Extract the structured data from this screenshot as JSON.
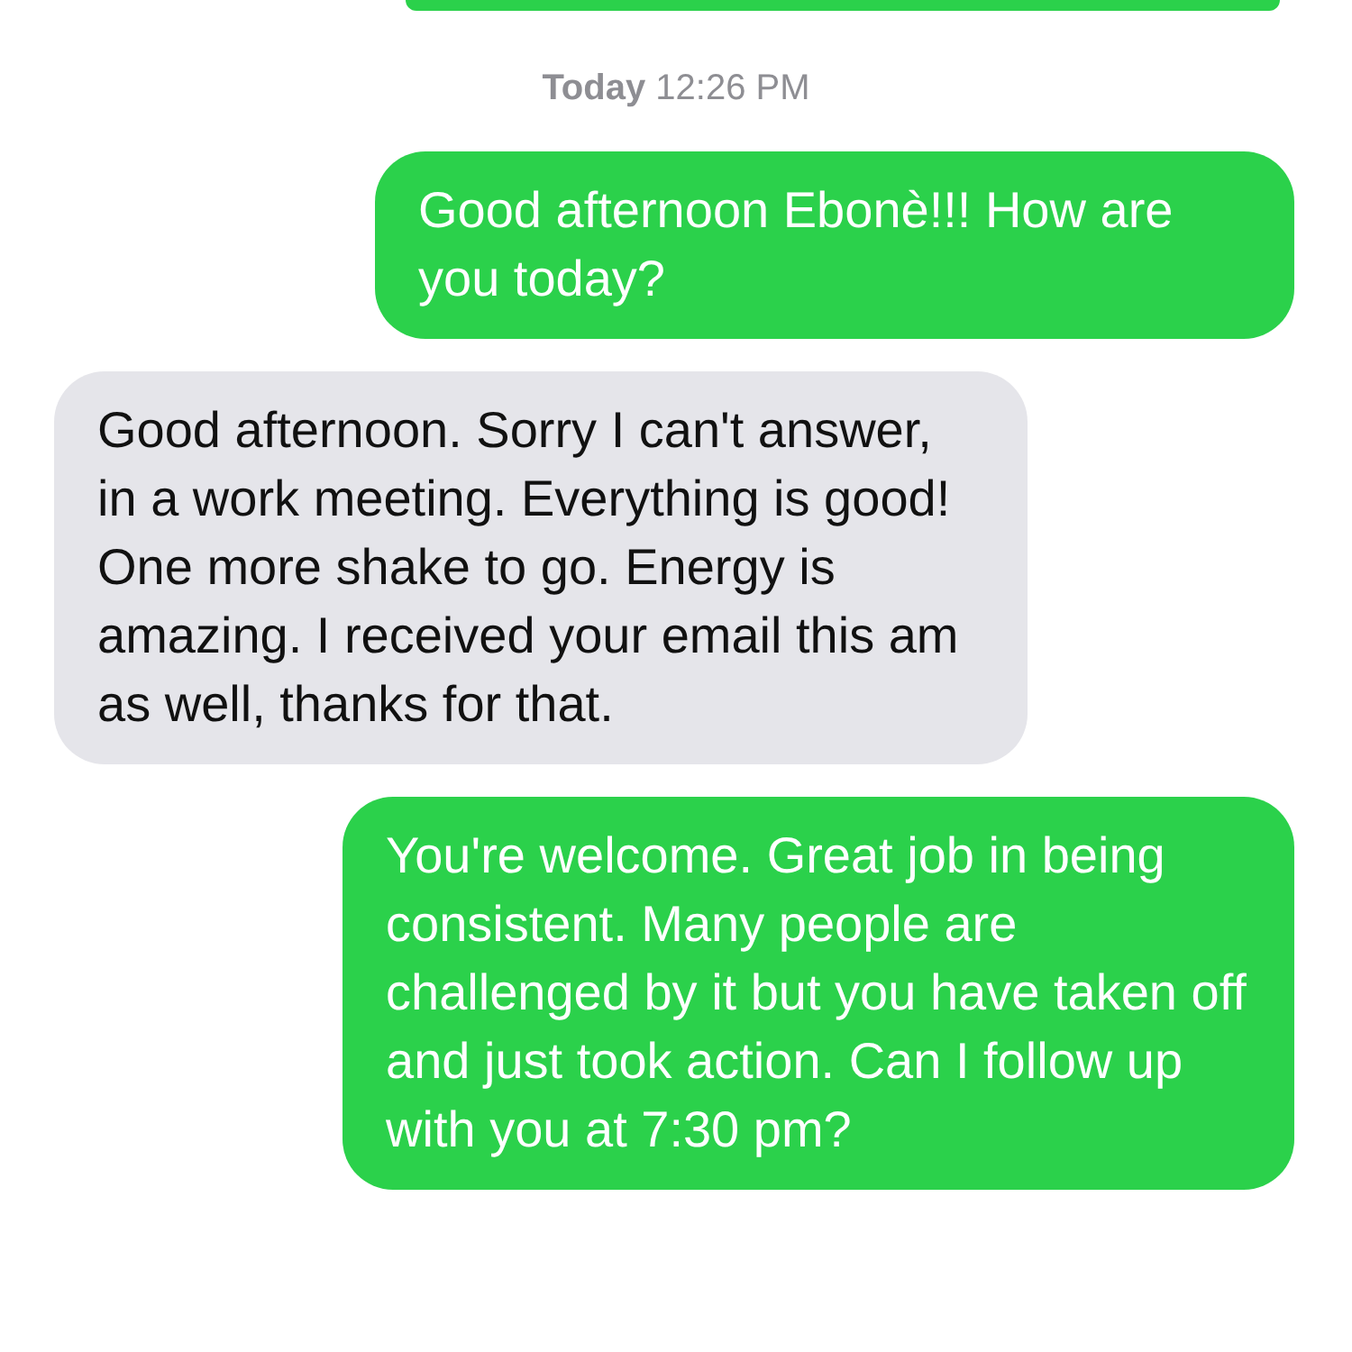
{
  "timestamp": {
    "day": "Today",
    "time": "12:26 PM"
  },
  "messages": [
    {
      "kind": "sent",
      "text": "Good afternoon Ebonè!!! How are you today?"
    },
    {
      "kind": "received",
      "text": "Good afternoon. Sorry I can't answer, in a work meeting. Everything is good! One more shake to go. Energy is amazing. I received your email this am as well, thanks for that."
    },
    {
      "kind": "sent",
      "text": "You're welcome. Great job in being consistent. Many people are challenged by it but you have taken off and just took action. Can I follow up with you at 7:30 pm?"
    }
  ]
}
